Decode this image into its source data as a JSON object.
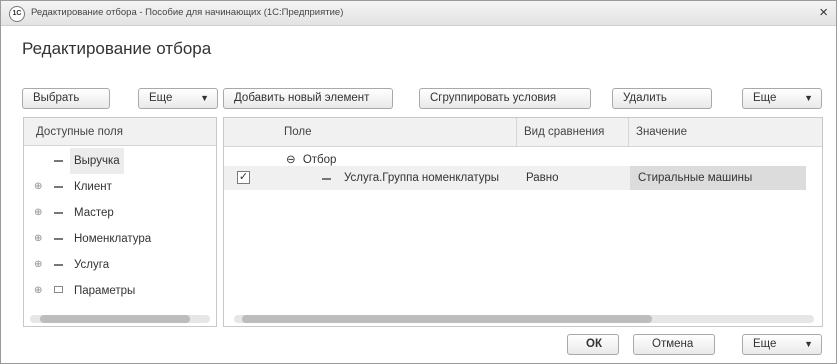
{
  "window": {
    "title": "Редактирование отбора - Пособие для начинающих (1С:Предприятие)",
    "logo": "1С",
    "close": "×"
  },
  "header": {
    "title": "Редактирование отбора"
  },
  "left_toolbar": {
    "select": "Выбрать",
    "more": "Еще"
  },
  "right_toolbar": {
    "add": "Добавить новый элемент",
    "group": "Сгруппировать условия",
    "delete": "Удалить",
    "more": "Еще"
  },
  "fields_panel": {
    "header": "Доступные поля",
    "items": [
      {
        "label": "Выручка",
        "expandable": false,
        "icon": "field-icon",
        "selected": true
      },
      {
        "label": "Клиент",
        "expandable": true,
        "icon": "field-icon"
      },
      {
        "label": "Мастер",
        "expandable": true,
        "icon": "field-icon"
      },
      {
        "label": "Номенклатура",
        "expandable": true,
        "icon": "field-icon"
      },
      {
        "label": "Услуга",
        "expandable": true,
        "icon": "field-icon"
      },
      {
        "label": "Параметры",
        "expandable": true,
        "icon": "folder-icon"
      }
    ]
  },
  "filter_grid": {
    "columns": {
      "field": "Поле",
      "comparison": "Вид сравнения",
      "value": "Значение"
    },
    "group_row": {
      "expander": "⊖",
      "label": "Отбор"
    },
    "rows": [
      {
        "checked": true,
        "field": "Услуга.Группа номенклатуры",
        "comparison": "Равно",
        "value": "Стиральные машины"
      }
    ]
  },
  "footer": {
    "ok": "ОК",
    "cancel": "Отмена",
    "more": "Еще"
  },
  "icons": {
    "expand": "⊕",
    "dropdown": "▼",
    "check": "✓"
  }
}
